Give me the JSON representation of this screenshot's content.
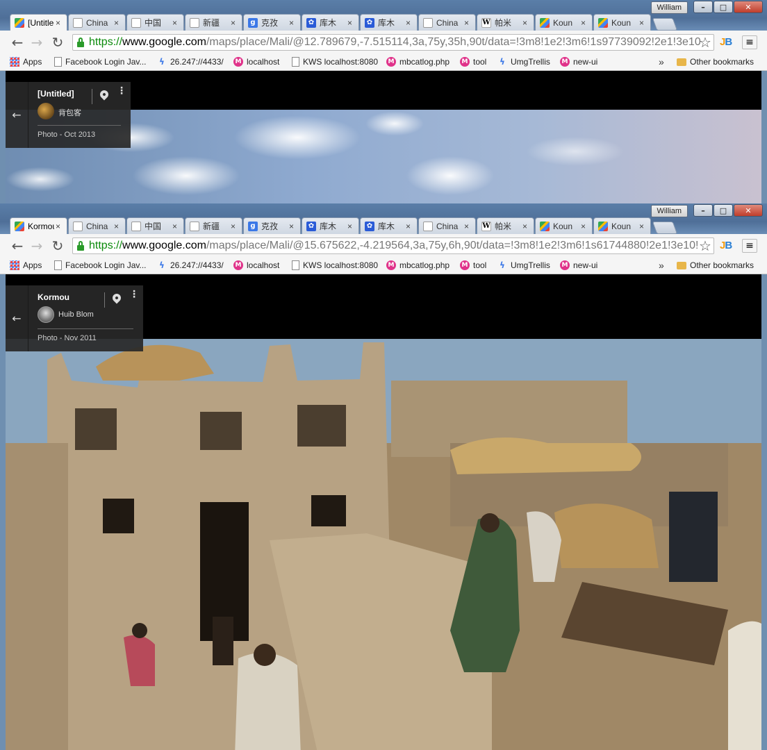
{
  "windows": [
    {
      "user_badge": "William",
      "tabs": [
        {
          "title": "[Untitled]",
          "favicon": "maps-icon",
          "active": true
        },
        {
          "title": "China",
          "favicon": "page-icon"
        },
        {
          "title": "中国",
          "favicon": "page-icon"
        },
        {
          "title": "新疆",
          "favicon": "page-icon"
        },
        {
          "title": "克孜",
          "favicon": "google-search-icon"
        },
        {
          "title": "库木",
          "favicon": "baidu-icon"
        },
        {
          "title": "库木",
          "favicon": "baidu-icon"
        },
        {
          "title": "China",
          "favicon": "page-icon"
        },
        {
          "title": "帕米",
          "favicon": "wikipedia-icon"
        },
        {
          "title": "Koun",
          "favicon": "maps-icon"
        },
        {
          "title": "Koun",
          "favicon": "maps-icon"
        }
      ],
      "url": {
        "protocol": "https://",
        "host": "www.google.com",
        "path": "/maps/place/Mali/@12.789679,-7.515114,3a,75y,35h,90t/data=!3m8!1e2!3m6!1s97739092!2e1!3e10"
      },
      "info_card": {
        "title": "[Untitled]",
        "author": "背包客",
        "date": "Photo - Oct 2013"
      }
    },
    {
      "user_badge": "William",
      "tabs": [
        {
          "title": "Kormou",
          "favicon": "maps-icon",
          "active": true
        },
        {
          "title": "China",
          "favicon": "page-icon"
        },
        {
          "title": "中国",
          "favicon": "page-icon"
        },
        {
          "title": "新疆",
          "favicon": "page-icon"
        },
        {
          "title": "克孜",
          "favicon": "google-search-icon"
        },
        {
          "title": "库木",
          "favicon": "baidu-icon"
        },
        {
          "title": "库木",
          "favicon": "baidu-icon"
        },
        {
          "title": "China",
          "favicon": "page-icon"
        },
        {
          "title": "帕米",
          "favicon": "wikipedia-icon"
        },
        {
          "title": "Koun",
          "favicon": "maps-icon"
        },
        {
          "title": "Koun",
          "favicon": "maps-icon"
        }
      ],
      "url": {
        "protocol": "https://",
        "host": "www.google.com",
        "path": "/maps/place/Mali/@15.675622,-4.219564,3a,75y,6h,90t/data=!3m8!1e2!3m6!1s61744880!2e1!3e10!"
      },
      "info_card": {
        "title": "Kormou",
        "author": "Huib Blom",
        "date": "Photo - Nov 2011"
      }
    }
  ],
  "bookmarks": [
    {
      "label": "Apps",
      "icon": "apps-icon"
    },
    {
      "label": "Facebook Login Jav...",
      "icon": "page-icon"
    },
    {
      "label": "26.247://4433/",
      "icon": "bolt-icon"
    },
    {
      "label": "localhost",
      "icon": "pink-m-icon"
    },
    {
      "label": "KWS localhost:8080",
      "icon": "page-icon"
    },
    {
      "label": "mbcatlog.php",
      "icon": "pink-m-icon"
    },
    {
      "label": "tool",
      "icon": "pink-m-icon"
    },
    {
      "label": "UmgTrellis",
      "icon": "bolt-icon"
    },
    {
      "label": "new-ui",
      "icon": "pink-m-icon"
    }
  ],
  "bookmarks_more": "»",
  "other_bookmarks": "Other bookmarks",
  "window_controls": {
    "minimize": "–",
    "maximize": "□",
    "close": "✕"
  },
  "toolbar": {
    "back": "←",
    "forward": "→",
    "reload": "↻",
    "star": "☆",
    "menu": "≡",
    "ext": "JB"
  },
  "card_back_glyph": "←",
  "card_more_glyph": "⋮",
  "tab_close_glyph": "×"
}
